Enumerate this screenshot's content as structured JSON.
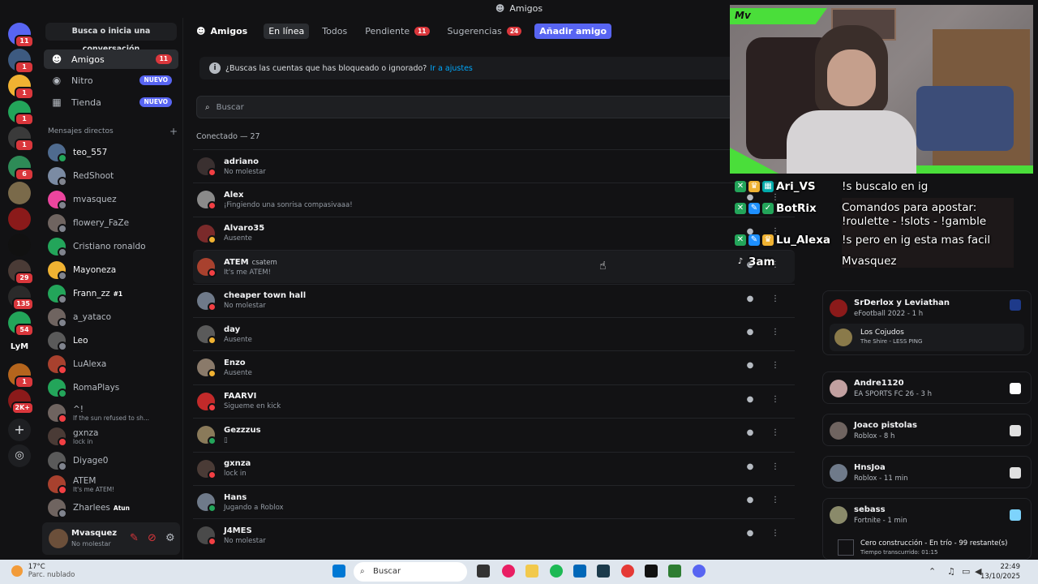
{
  "window": {
    "title": "Amigos"
  },
  "rail": {
    "badges": [
      "11",
      "1",
      "1",
      "1",
      "1",
      "6",
      "29",
      "135",
      "54",
      "1",
      "2K+"
    ],
    "lym": "LyM"
  },
  "sidebar": {
    "find": "Busca o inicia una conversación",
    "nav": [
      {
        "label": "Amigos",
        "badge": "11"
      },
      {
        "label": "Nitro",
        "badge": "NUEVO"
      },
      {
        "label": "Tienda",
        "badge": "NUEVO"
      }
    ],
    "dm_header": "Mensajes directos",
    "dms": [
      {
        "name": "teo_557",
        "sub": "",
        "color": "#4f6b8f",
        "status": "#23a55a"
      },
      {
        "name": "RedShoot",
        "sub": "",
        "color": "#7b8ba3",
        "status": "#80848e"
      },
      {
        "name": "mvasquez",
        "sub": "",
        "color": "#eb459e",
        "status": "#80848e"
      },
      {
        "name": "flowery_FaZe",
        "sub": "",
        "color": "#6f6460",
        "status": "#80848e"
      },
      {
        "name": "Cristiano ronaldo",
        "sub": "",
        "color": "#23a55a",
        "status": "#80848e"
      },
      {
        "name": "Mayoneza",
        "sub": "",
        "color": "#f0b232",
        "status": "#80848e"
      },
      {
        "name": "Frann_zz",
        "sub": "",
        "tag": "#1",
        "color": "#23a55a",
        "status": "#80848e"
      },
      {
        "name": "a_yataco",
        "sub": "",
        "color": "#6f6460",
        "status": "#80848e"
      },
      {
        "name": "Leo",
        "sub": "",
        "color": "#5a5a5a",
        "status": "#80848e"
      },
      {
        "name": "LuAlexa",
        "sub": "",
        "color": "#a8412e",
        "status": "#f23f43"
      },
      {
        "name": "RomaPlays",
        "sub": "",
        "color": "#23a55a",
        "status": "#23a55a"
      },
      {
        "name": "^!",
        "sub": "If the sun refused to sh...",
        "color": "#6f6460",
        "status": "#f23f43"
      },
      {
        "name": "gxnza",
        "sub": "lock in",
        "color": "#4a3b36",
        "status": "#f23f43"
      },
      {
        "name": "Diyage0",
        "sub": "",
        "color": "#5a5a5a",
        "status": "#80848e"
      },
      {
        "name": "ATEM",
        "sub": "It's me ATEM!",
        "color": "#a8412e",
        "status": "#f23f43"
      },
      {
        "name": "Zharlees",
        "sub": "",
        "tag": "Atun",
        "color": "#6f6460",
        "status": "#80848e"
      }
    ],
    "user": {
      "name": "Mvasquez",
      "status": "No molestar"
    }
  },
  "tabs": {
    "title": "Amigos",
    "items": [
      {
        "label": "En línea"
      },
      {
        "label": "Todos"
      },
      {
        "label": "Pendiente",
        "count": "11"
      },
      {
        "label": "Sugerencias",
        "count": "24"
      }
    ],
    "add": "Añadir amigo"
  },
  "notice": {
    "text": "¿Buscas las cuentas que has bloqueado o ignorado?",
    "link": "Ir a ajustes"
  },
  "search": {
    "placeholder": "Buscar"
  },
  "connected": "Conectado — 27",
  "friends": [
    {
      "name": "adriano",
      "status": "No molestar",
      "color": "#3a3030",
      "dot": "#f23f43"
    },
    {
      "name": "Alex",
      "status": "¡Fingiendo una sonrisa compasivaaa!",
      "color": "#8a8a8a",
      "dot": "#f23f43"
    },
    {
      "name": "Alvaro35",
      "status": "Ausente",
      "color": "#7a2a2a",
      "dot": "#f0b232"
    },
    {
      "name": "ATEM",
      "tag": "csatem",
      "status": "It's me ATEM!",
      "color": "#a8412e",
      "dot": "#f23f43"
    },
    {
      "name": "cheaper town hall",
      "status": "No molestar",
      "color": "#6f7a8a",
      "dot": "#f23f43"
    },
    {
      "name": "day",
      "status": "Ausente",
      "color": "#5a5a5a",
      "dot": "#f0b232"
    },
    {
      "name": "Enzo",
      "status": "Ausente",
      "color": "#8a7a6a",
      "dot": "#f0b232"
    },
    {
      "name": "FAARVI",
      "status": "Sigueme en kick",
      "color": "#c22a2a",
      "dot": "#f23f43"
    },
    {
      "name": "Gezzzus",
      "status": "▯",
      "color": "#8a7a5a",
      "dot": "#23a55a"
    },
    {
      "name": "gxnza",
      "status": "lock in",
      "color": "#4a3b36",
      "dot": "#f23f43"
    },
    {
      "name": "Hans",
      "status": "Jugando a Roblox",
      "color": "#6f7a8a",
      "dot": "#23a55a"
    },
    {
      "name": "J4MES",
      "status": "No molestar",
      "color": "#4a4a4a",
      "dot": "#f23f43"
    }
  ],
  "stream": {
    "brand": "Mv",
    "chat": [
      {
        "user": "Ari_VS",
        "message": "!s buscalo en ig"
      },
      {
        "user": "BotRix",
        "message": "Comandos para apostar:"
      },
      {
        "user": "",
        "message": "!roulette - !slots - !gamble"
      },
      {
        "user": "Lu_Alexa",
        "message": "!s pero en ig esta mas facil"
      },
      {
        "user": "3am",
        "message": "Mvasquez"
      }
    ]
  },
  "activity": [
    {
      "name": "SrDerlox y Leviathan",
      "sub": "eFootball 2022 - 1 h",
      "group": "Los Cojudos",
      "group_sub": "The Shire - LESS PING"
    },
    {
      "name": "Andre1120",
      "sub": "EA SPORTS FC 26 - 3 h"
    },
    {
      "name": "Joaco pistolas",
      "sub": "Roblox - 8 h"
    },
    {
      "name": "HnsJoa",
      "sub": "Roblox - 11 min"
    },
    {
      "name": "sebass",
      "sub": "Fortnite - 1 min"
    },
    {
      "name": "Cero construcción - En trío - 99 restante(s)",
      "sub": "Tiempo transcurrido: 01:15"
    }
  ],
  "taskbar": {
    "temp": "17°C",
    "weather": "Parc. nublado",
    "search": "Buscar",
    "time": "22:49",
    "date": "13/10/2025"
  },
  "colors": {
    "accent": "#5865f2",
    "danger": "#da373c",
    "online": "#23a55a",
    "stream_green": "#4ade3a"
  }
}
